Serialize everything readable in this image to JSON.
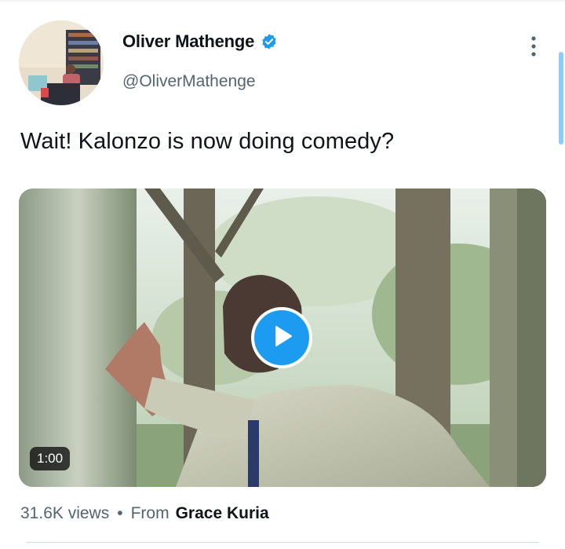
{
  "author": {
    "name": "Oliver Mathenge",
    "handle": "@OliverMathenge",
    "verified": true
  },
  "tweet": {
    "text": "Wait! Kalonzo is now doing comedy?"
  },
  "media": {
    "type": "video",
    "duration": "1:00"
  },
  "stats": {
    "views": "31.6K views",
    "separator": "•",
    "from_label": "From",
    "source": "Grace Kuria"
  },
  "colors": {
    "accent": "#1d9bf0",
    "text_primary": "#0f1419",
    "text_secondary": "#536471"
  },
  "icons": {
    "verified": "verified-badge-icon",
    "more": "more-options-icon",
    "play": "play-icon"
  }
}
